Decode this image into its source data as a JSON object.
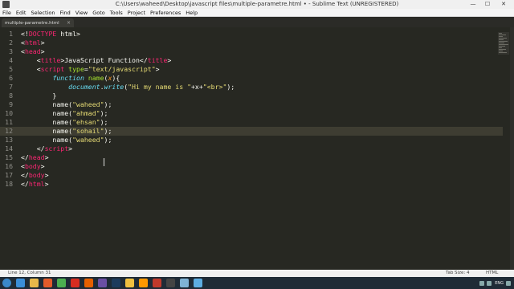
{
  "window": {
    "title": "C:\\Users\\waheed\\Desktop\\javascript files\\multiple-parametre.html • - Sublime Text (UNREGISTERED)",
    "minimize": "—",
    "maximize": "☐",
    "close": "✕"
  },
  "menu": [
    "File",
    "Edit",
    "Selection",
    "Find",
    "View",
    "Goto",
    "Tools",
    "Project",
    "Preferences",
    "Help"
  ],
  "tab": {
    "label": "multiple-parametre.html",
    "close": "×"
  },
  "editor": {
    "current_line": 12,
    "lines": [
      [
        {
          "t": "<!",
          "c": "plain"
        },
        {
          "t": "DOCTYPE",
          "c": "tag"
        },
        {
          "t": " html>",
          "c": "plain"
        }
      ],
      [
        {
          "t": "<",
          "c": "plain"
        },
        {
          "t": "html",
          "c": "tag"
        },
        {
          "t": ">",
          "c": "plain"
        }
      ],
      [
        {
          "t": "<",
          "c": "plain"
        },
        {
          "t": "head",
          "c": "tag"
        },
        {
          "t": ">",
          "c": "plain"
        }
      ],
      [
        {
          "t": "    <",
          "c": "plain"
        },
        {
          "t": "title",
          "c": "tag"
        },
        {
          "t": ">JavaScript Function</",
          "c": "plain"
        },
        {
          "t": "title",
          "c": "tag"
        },
        {
          "t": ">",
          "c": "plain"
        }
      ],
      [
        {
          "t": "    <",
          "c": "plain"
        },
        {
          "t": "script",
          "c": "tag"
        },
        {
          "t": " ",
          "c": "plain"
        },
        {
          "t": "type",
          "c": "attr"
        },
        {
          "t": "=",
          "c": "plain"
        },
        {
          "t": "\"text/javascript\"",
          "c": "str"
        },
        {
          "t": ">",
          "c": "plain"
        }
      ],
      [
        {
          "t": "        ",
          "c": "plain"
        },
        {
          "t": "function",
          "c": "kw"
        },
        {
          "t": " ",
          "c": "plain"
        },
        {
          "t": "name",
          "c": "fn"
        },
        {
          "t": "(",
          "c": "plain"
        },
        {
          "t": "x",
          "c": "param"
        },
        {
          "t": "){",
          "c": "plain"
        }
      ],
      [
        {
          "t": "            ",
          "c": "plain"
        },
        {
          "t": "document",
          "c": "doc"
        },
        {
          "t": ".",
          "c": "plain"
        },
        {
          "t": "write",
          "c": "doc"
        },
        {
          "t": "(",
          "c": "plain"
        },
        {
          "t": "\"Hi my name is \"",
          "c": "str"
        },
        {
          "t": "+x+",
          "c": "plain"
        },
        {
          "t": "\"<br>\"",
          "c": "str"
        },
        {
          "t": ");",
          "c": "plain"
        }
      ],
      [
        {
          "t": "        }",
          "c": "plain"
        }
      ],
      [
        {
          "t": "        name(",
          "c": "plain"
        },
        {
          "t": "\"waheed\"",
          "c": "str"
        },
        {
          "t": ");",
          "c": "plain"
        }
      ],
      [
        {
          "t": "        name(",
          "c": "plain"
        },
        {
          "t": "\"ahmad\"",
          "c": "str"
        },
        {
          "t": ");",
          "c": "plain"
        }
      ],
      [
        {
          "t": "        name(",
          "c": "plain"
        },
        {
          "t": "\"ehsan\"",
          "c": "str"
        },
        {
          "t": ");",
          "c": "plain"
        }
      ],
      [
        {
          "t": "        name(",
          "c": "plain"
        },
        {
          "t": "\"sohail\"",
          "c": "str"
        },
        {
          "t": ");",
          "c": "plain"
        }
      ],
      [
        {
          "t": "        name(",
          "c": "plain"
        },
        {
          "t": "\"waheed\"",
          "c": "str"
        },
        {
          "t": ");",
          "c": "plain"
        }
      ],
      [
        {
          "t": "    </",
          "c": "plain"
        },
        {
          "t": "script",
          "c": "tag"
        },
        {
          "t": ">",
          "c": "plain"
        }
      ],
      [
        {
          "t": "</",
          "c": "plain"
        },
        {
          "t": "head",
          "c": "tag"
        },
        {
          "t": ">",
          "c": "plain"
        }
      ],
      [
        {
          "t": "<",
          "c": "plain"
        },
        {
          "t": "body",
          "c": "tag"
        },
        {
          "t": ">",
          "c": "plain"
        }
      ],
      [
        {
          "t": "</",
          "c": "plain"
        },
        {
          "t": "body",
          "c": "tag"
        },
        {
          "t": ">",
          "c": "plain"
        }
      ],
      [
        {
          "t": "</",
          "c": "plain"
        },
        {
          "t": "html",
          "c": "tag"
        },
        {
          "t": ">",
          "c": "plain"
        }
      ]
    ]
  },
  "status": {
    "position": "Line 12, Column 31",
    "tab_size": "Tab Size: 4",
    "syntax": "HTML"
  },
  "taskbar": {
    "icons": [
      {
        "name": "ie-icon",
        "color": "#3b8ed8"
      },
      {
        "name": "folder-icon",
        "color": "#e8b84a"
      },
      {
        "name": "media-icon",
        "color": "#e25b2a"
      },
      {
        "name": "chrome-icon",
        "color": "#4caf50"
      },
      {
        "name": "youtube-icon",
        "color": "#d62d20"
      },
      {
        "name": "firefox-icon",
        "color": "#e66000"
      },
      {
        "name": "app-icon",
        "color": "#6a4fa3"
      },
      {
        "name": "photoshop-icon",
        "color": "#1d3b5c"
      },
      {
        "name": "files-icon",
        "color": "#f0c040"
      },
      {
        "name": "sublime-icon",
        "color": "#ff9800"
      },
      {
        "name": "app2-icon",
        "color": "#c0392b"
      },
      {
        "name": "terminal-icon",
        "color": "#444444"
      },
      {
        "name": "app3-icon",
        "color": "#7fb3d5"
      },
      {
        "name": "app4-icon",
        "color": "#5dade2"
      }
    ],
    "language": "ENG"
  },
  "colors": {
    "editor_bg": "#272822",
    "tag": "#f92672",
    "string": "#e6db74",
    "keyword": "#66d9ef",
    "function": "#a6e22e",
    "param": "#fd971f"
  }
}
